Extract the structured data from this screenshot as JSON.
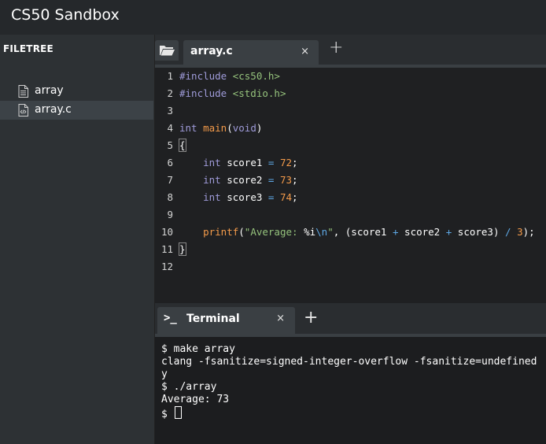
{
  "app": {
    "title": "CS50 Sandbox"
  },
  "sidebar": {
    "header": "FILETREE",
    "items": [
      {
        "label": "array",
        "icon": "file-icon"
      },
      {
        "label": "array.c",
        "icon": "code-file-icon",
        "selected": true
      }
    ]
  },
  "editor_tabs": {
    "active": {
      "label": "array.c",
      "close": "×"
    },
    "add": "+"
  },
  "code": {
    "line_numbers": [
      "1",
      "2",
      "3",
      "4",
      "5",
      "6",
      "7",
      "8",
      "9",
      "10",
      "11",
      "12"
    ],
    "lines": [
      [
        {
          "t": "#include ",
          "c": "kw"
        },
        {
          "t": "<cs50.h>",
          "c": "str"
        }
      ],
      [
        {
          "t": "#include ",
          "c": "kw"
        },
        {
          "t": "<stdio.h>",
          "c": "str"
        }
      ],
      [],
      [
        {
          "t": "int ",
          "c": "kw"
        },
        {
          "t": "main",
          "c": "num"
        },
        {
          "t": "(",
          "c": ""
        },
        {
          "t": "void",
          "c": "kw"
        },
        {
          "t": ")",
          "c": ""
        }
      ],
      [
        {
          "t": "{",
          "c": "brace"
        }
      ],
      [
        {
          "t": "    ",
          "c": ""
        },
        {
          "t": "int ",
          "c": "kw"
        },
        {
          "t": "score1 ",
          "c": ""
        },
        {
          "t": "= ",
          "c": "op"
        },
        {
          "t": "72",
          "c": "num"
        },
        {
          "t": ";",
          "c": ""
        }
      ],
      [
        {
          "t": "    ",
          "c": ""
        },
        {
          "t": "int ",
          "c": "kw"
        },
        {
          "t": "score2 ",
          "c": ""
        },
        {
          "t": "= ",
          "c": "op"
        },
        {
          "t": "73",
          "c": "num"
        },
        {
          "t": ";",
          "c": ""
        }
      ],
      [
        {
          "t": "    ",
          "c": ""
        },
        {
          "t": "int ",
          "c": "kw"
        },
        {
          "t": "score3 ",
          "c": ""
        },
        {
          "t": "= ",
          "c": "op"
        },
        {
          "t": "74",
          "c": "num"
        },
        {
          "t": ";",
          "c": ""
        }
      ],
      [],
      [
        {
          "t": "    ",
          "c": ""
        },
        {
          "t": "printf",
          "c": "num"
        },
        {
          "t": "(",
          "c": ""
        },
        {
          "t": "\"Average: ",
          "c": "str"
        },
        {
          "t": "%i",
          "c": ""
        },
        {
          "t": "\\n",
          "c": "op"
        },
        {
          "t": "\"",
          "c": "str"
        },
        {
          "t": ", (score1 ",
          "c": ""
        },
        {
          "t": "+ ",
          "c": "op"
        },
        {
          "t": "score2 ",
          "c": ""
        },
        {
          "t": "+ ",
          "c": "op"
        },
        {
          "t": "score3) ",
          "c": ""
        },
        {
          "t": "/ ",
          "c": "op"
        },
        {
          "t": "3",
          "c": "num"
        },
        {
          "t": ");",
          "c": ""
        }
      ],
      [
        {
          "t": "}",
          "c": "brace"
        }
      ],
      []
    ]
  },
  "terminal_tabs": {
    "active": {
      "prompt_icon": ">_",
      "label": "Terminal",
      "close": "×"
    },
    "add": "+"
  },
  "terminal": {
    "lines": [
      "$ make array",
      "clang -fsanitize=signed-integer-overflow -fsanitize=undefined",
      "y",
      "$ ./array",
      "Average: 73",
      "$ "
    ]
  }
}
